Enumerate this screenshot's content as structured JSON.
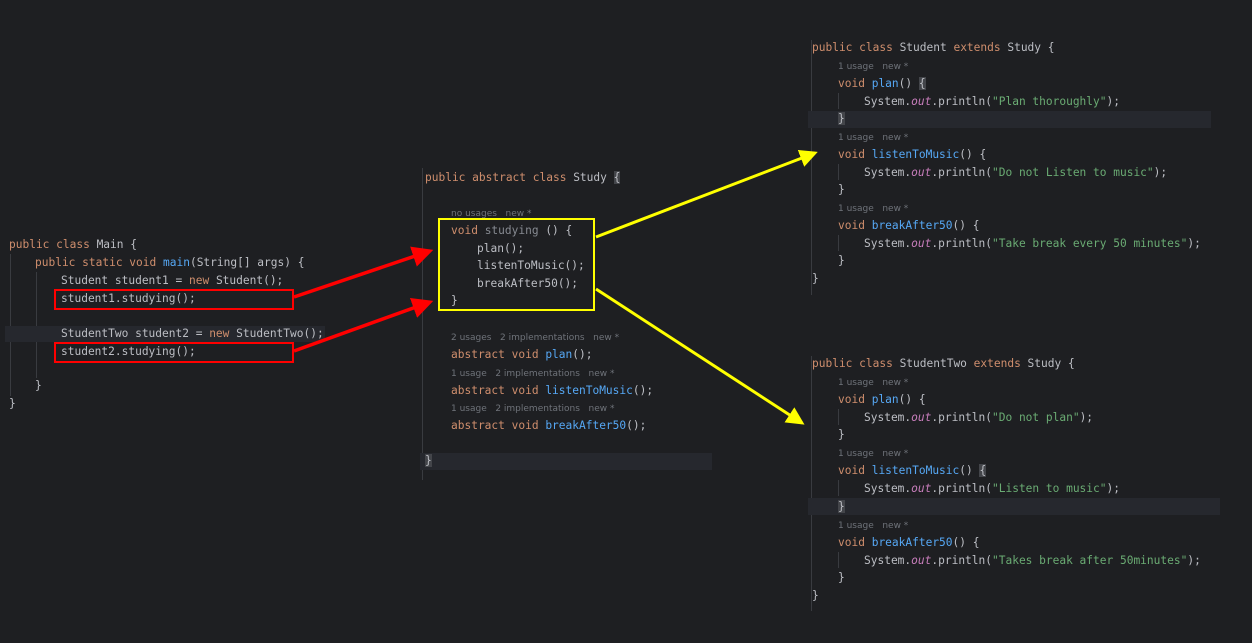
{
  "main_panel": {
    "class_line": {
      "kw": "public class",
      "name": " Main {"
    },
    "method_line": {
      "kw1": "public static void",
      "sp": " ",
      "fn": "main",
      "rest": "(String[] args) {"
    },
    "student1_decl": {
      "type": "Student student1 = ",
      "kw": "new",
      "rest": " Student();"
    },
    "student1_call": "student1.studying();",
    "student2_decl": {
      "type": "StudentTwo student2 = ",
      "kw": "new",
      "rest": " StudentTwo();"
    },
    "student2_call": "student2.studying();",
    "close_method": "}",
    "close_class": "}"
  },
  "study_panel": {
    "class_line": {
      "kw": "public abstract class",
      "name": " Study ",
      "brace": "{"
    },
    "hint_studying": "no usages   new *",
    "studying_line": {
      "kw": "void",
      "name": " studying",
      "rest": " () {"
    },
    "call_plan": "plan();",
    "call_listen": "listenToMusic();",
    "call_break": "breakAfter50();",
    "close_studying": "}",
    "hint_plan": "2 usages   2 implementations   new *",
    "abstract_plan": {
      "kw": "abstract void",
      "fn": "plan",
      "rest": "();"
    },
    "hint_listen": "1 usage   2 implementations   new *",
    "abstract_listen": {
      "kw": "abstract void",
      "fn": "listenToMusic",
      "rest": "();"
    },
    "hint_break": "1 usage   2 implementations   new *",
    "abstract_break": {
      "kw": "abstract void",
      "fn": "breakAfter50",
      "rest": "();"
    },
    "close_class": "}"
  },
  "student_panel": {
    "class_line": {
      "kw1": "public class",
      "name": " Student ",
      "kw2": "extends",
      "rest": " Study {"
    },
    "hint_plan": "1 usage   new *",
    "plan_line": {
      "kw": "void",
      "fn": "plan",
      "rest": "() ",
      "brace": "{"
    },
    "plan_print": {
      "pre": "System.",
      "field": "out",
      "mid": ".println(",
      "str": "\"Plan thoroughly\"",
      "end": ");"
    },
    "close_plan": "}",
    "hint_listen": "1 usage   new *",
    "listen_line": {
      "kw": "void",
      "fn": "listenToMusic",
      "rest": "() {"
    },
    "listen_print": {
      "pre": "System.",
      "field": "out",
      "mid": ".println(",
      "str": "\"Do not Listen to music\"",
      "end": ");"
    },
    "close_listen": "}",
    "hint_break": "1 usage   new *",
    "break_line": {
      "kw": "void",
      "fn": "breakAfter50",
      "rest": "() {"
    },
    "break_print": {
      "pre": "System.",
      "field": "out",
      "mid": ".println(",
      "str": "\"Take break every 50 minutes\"",
      "end": ");"
    },
    "close_break": "}",
    "close_class": "}"
  },
  "studenttwo_panel": {
    "class_line": {
      "kw1": "public class",
      "name": " StudentTwo ",
      "kw2": "extends",
      "rest": " Study {"
    },
    "hint_plan": "1 usage   new *",
    "plan_line": {
      "kw": "void",
      "fn": "plan",
      "rest": "() {"
    },
    "plan_print": {
      "pre": "System.",
      "field": "out",
      "mid": ".println(",
      "str": "\"Do not plan\"",
      "end": ");"
    },
    "close_plan": "}",
    "hint_listen": "1 usage   new *",
    "listen_line": {
      "kw": "void",
      "fn": "listenToMusic",
      "rest": "() ",
      "brace": "{"
    },
    "listen_print": {
      "pre": "System.",
      "field": "out",
      "mid": ".println(",
      "str": "\"Listen to music\"",
      "end": ");"
    },
    "close_listen": "}",
    "hint_break": "1 usage   new *",
    "break_line": {
      "kw": "void",
      "fn": "breakAfter50",
      "rest": "() {"
    },
    "break_print": {
      "pre": "System.",
      "field": "out",
      "mid": ".println(",
      "str": "\"Takes break after 50minutes\"",
      "end": ");"
    },
    "close_break": "}",
    "close_class": "}"
  },
  "colors": {
    "background": "#1e1f22",
    "keyword": "#cf8e6d",
    "function": "#56a8f5",
    "string": "#6aab73",
    "static_field": "#c77dbb",
    "red_annotation": "#ff0000",
    "yellow_annotation": "#ffff00"
  }
}
